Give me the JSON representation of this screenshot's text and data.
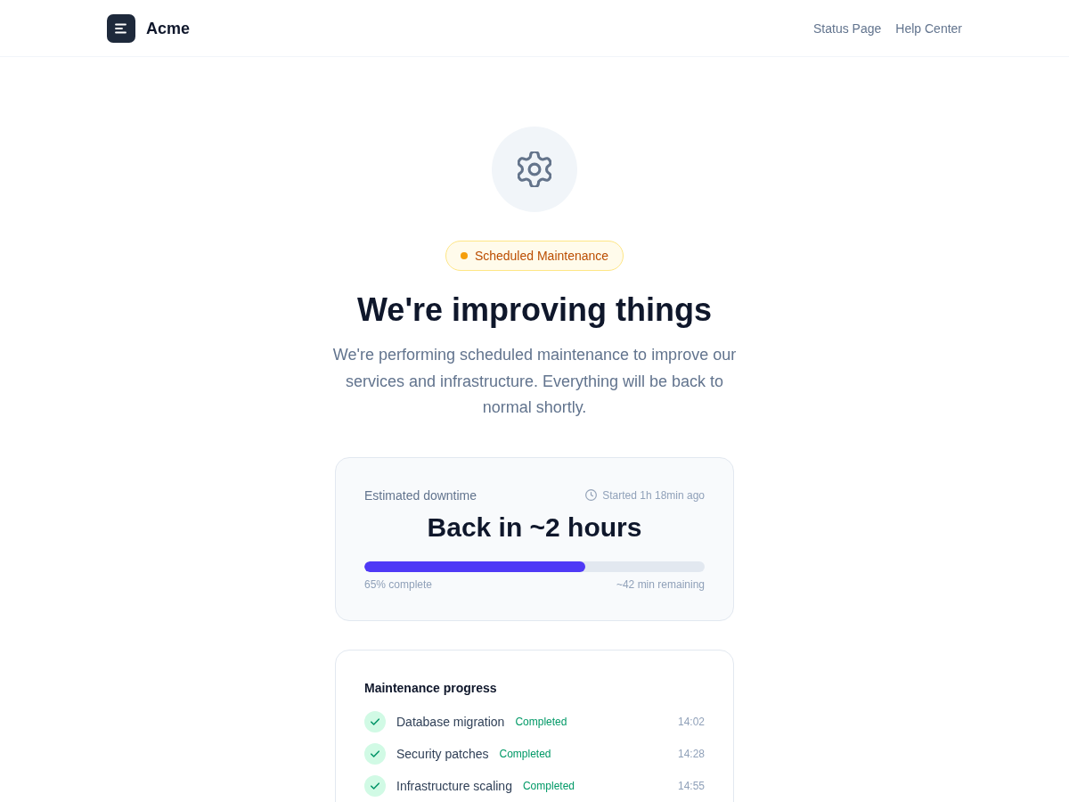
{
  "header": {
    "brand": "Acme",
    "nav_links": [
      "Status Page",
      "Help Center"
    ]
  },
  "badge": {
    "label": "Scheduled Maintenance"
  },
  "heading": "We're improving things",
  "description": "We're performing scheduled maintenance to improve our services and infrastructure. Everything will be back to normal shortly.",
  "downtime_card": {
    "label": "Estimated downtime",
    "started": "Started 1h 18min ago",
    "estimate": "Back in ~2 hours",
    "progress": {
      "level": 0.65,
      "complete_label": "65% complete",
      "remaining_label": "~42 min remaining"
    }
  },
  "progress_card": {
    "title": "Maintenance progress",
    "steps": [
      {
        "name": "Database migration",
        "status": "Completed",
        "done": true,
        "time": "14:02"
      },
      {
        "name": "Security patches",
        "status": "Completed",
        "done": true,
        "time": "14:28"
      },
      {
        "name": "Infrastructure scaling",
        "status": "Completed",
        "done": true,
        "time": "14:55"
      }
    ]
  }
}
